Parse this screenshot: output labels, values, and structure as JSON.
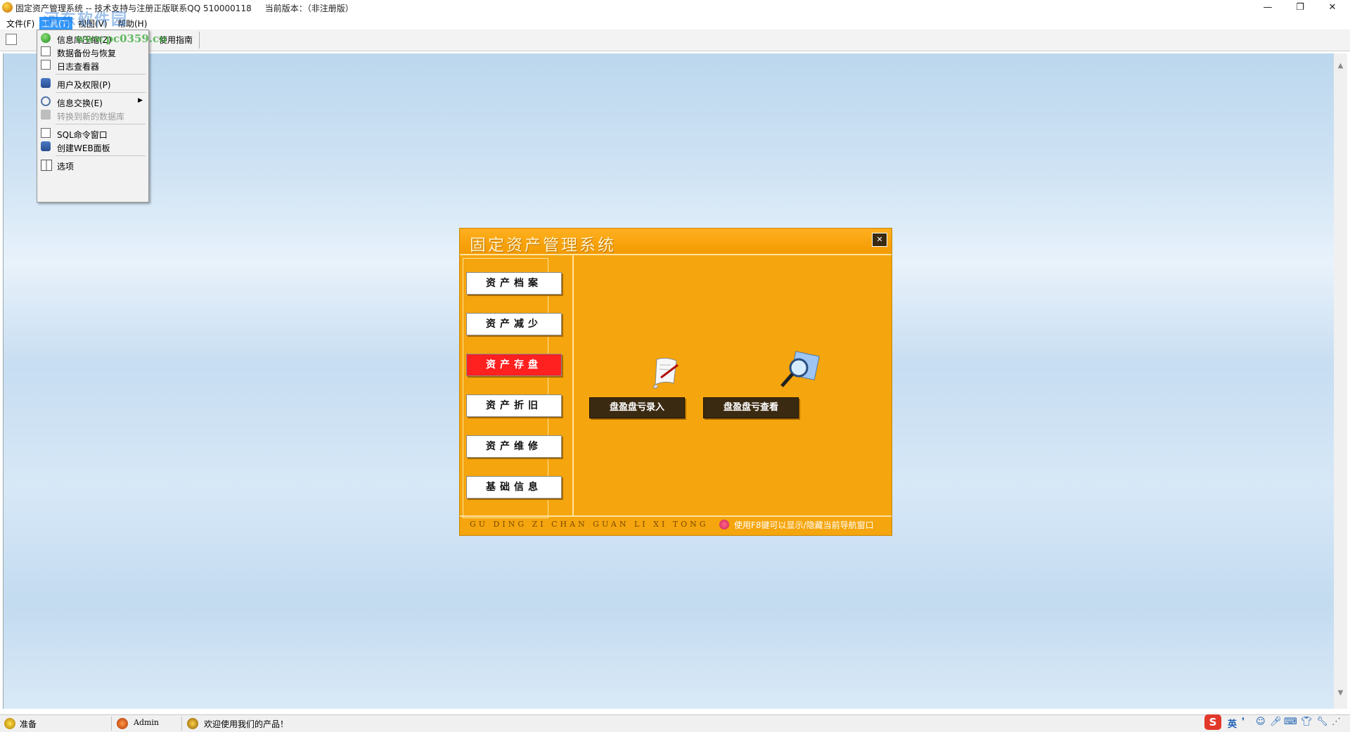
{
  "window": {
    "title": "固定资产管理系统 -- 技术支持与注册正版联系QQ 510000118     当前版本：（非注册版）",
    "min_glyph": "—",
    "max_glyph": "❐",
    "close_glyph": "✕"
  },
  "menubar": {
    "items": [
      "文件(F)",
      "工具(T)",
      "视图(V)",
      "帮助(H)"
    ]
  },
  "toolbar": {
    "guide_label": "使用指南"
  },
  "dropdown": {
    "items": [
      {
        "label": "信息库压缩(Z)",
        "icon": "database-compress-icon",
        "disabled": false
      },
      {
        "label": "数据备份与恢复",
        "icon": "backup-icon",
        "disabled": false
      },
      {
        "label": "日志查看器",
        "icon": "log-viewer-icon",
        "disabled": false
      },
      {
        "label": "用户及权限(P)",
        "icon": "users-icon",
        "disabled": false
      },
      {
        "label": "信息交换(E)",
        "icon": "exchange-icon",
        "disabled": false
      },
      {
        "label": "转换到新的数据库",
        "icon": "convert-db-icon",
        "disabled": true
      },
      {
        "label": "SQL命令窗口",
        "icon": "sql-window-icon",
        "disabled": false
      },
      {
        "label": "创建WEB面板",
        "icon": "web-panel-icon",
        "disabled": false
      },
      {
        "label": "选项",
        "icon": "options-icon",
        "disabled": false
      }
    ],
    "submenu_arrow": "▶"
  },
  "watermark": {
    "text": "河东软件园",
    "url": "www.pc0359.cn"
  },
  "nav_window": {
    "title": "固定资产管理系统",
    "close_glyph": "✕",
    "left_buttons": [
      "资产档案",
      "资产减少",
      "资产存盘",
      "资产折旧",
      "资产维修",
      "基础信息"
    ],
    "active_button": "资产存盘",
    "actions": [
      "盘盈盘亏录入",
      "盘盈盘亏查看"
    ],
    "footer_pinyin": "GU DING ZI CHAN GUAN LI XI TONG",
    "footer_hint": "使用F8键可以显示/隐藏当前导航窗口",
    "colors": {
      "panel": "#f5a50d",
      "active": "#ff2020",
      "action": "#3b2a12"
    }
  },
  "statusbar": {
    "ready": "准备",
    "user": "Admin",
    "welcome": "欢迎使用我们的产品！",
    "ime": "英"
  }
}
